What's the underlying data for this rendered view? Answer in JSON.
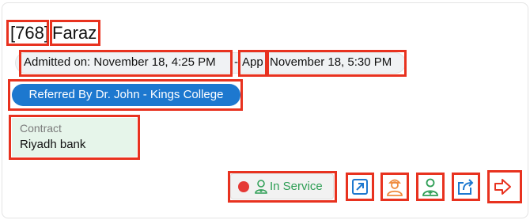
{
  "patient": {
    "id": "[768]",
    "name": "Faraz"
  },
  "visit": {
    "admitted": "Admitted on: November 18, 4:25 PM",
    "separator": "-",
    "app_label": "App",
    "appointment_time": "November 18, 5:30 PM"
  },
  "referral": {
    "label": "Referred By Dr. John - Kings College"
  },
  "contract": {
    "label": "Contract",
    "value": "Riyadh bank"
  },
  "status": {
    "label": "In Service",
    "dot_color": "#e53935",
    "text_color": "#2e9e55"
  },
  "actions": {
    "icons": [
      "open-external-icon",
      "doctor-icon",
      "staff-icon",
      "share-icon",
      "discharge-icon"
    ]
  },
  "colors": {
    "accent": "#1d78cf",
    "highlight": "#e8321f"
  }
}
